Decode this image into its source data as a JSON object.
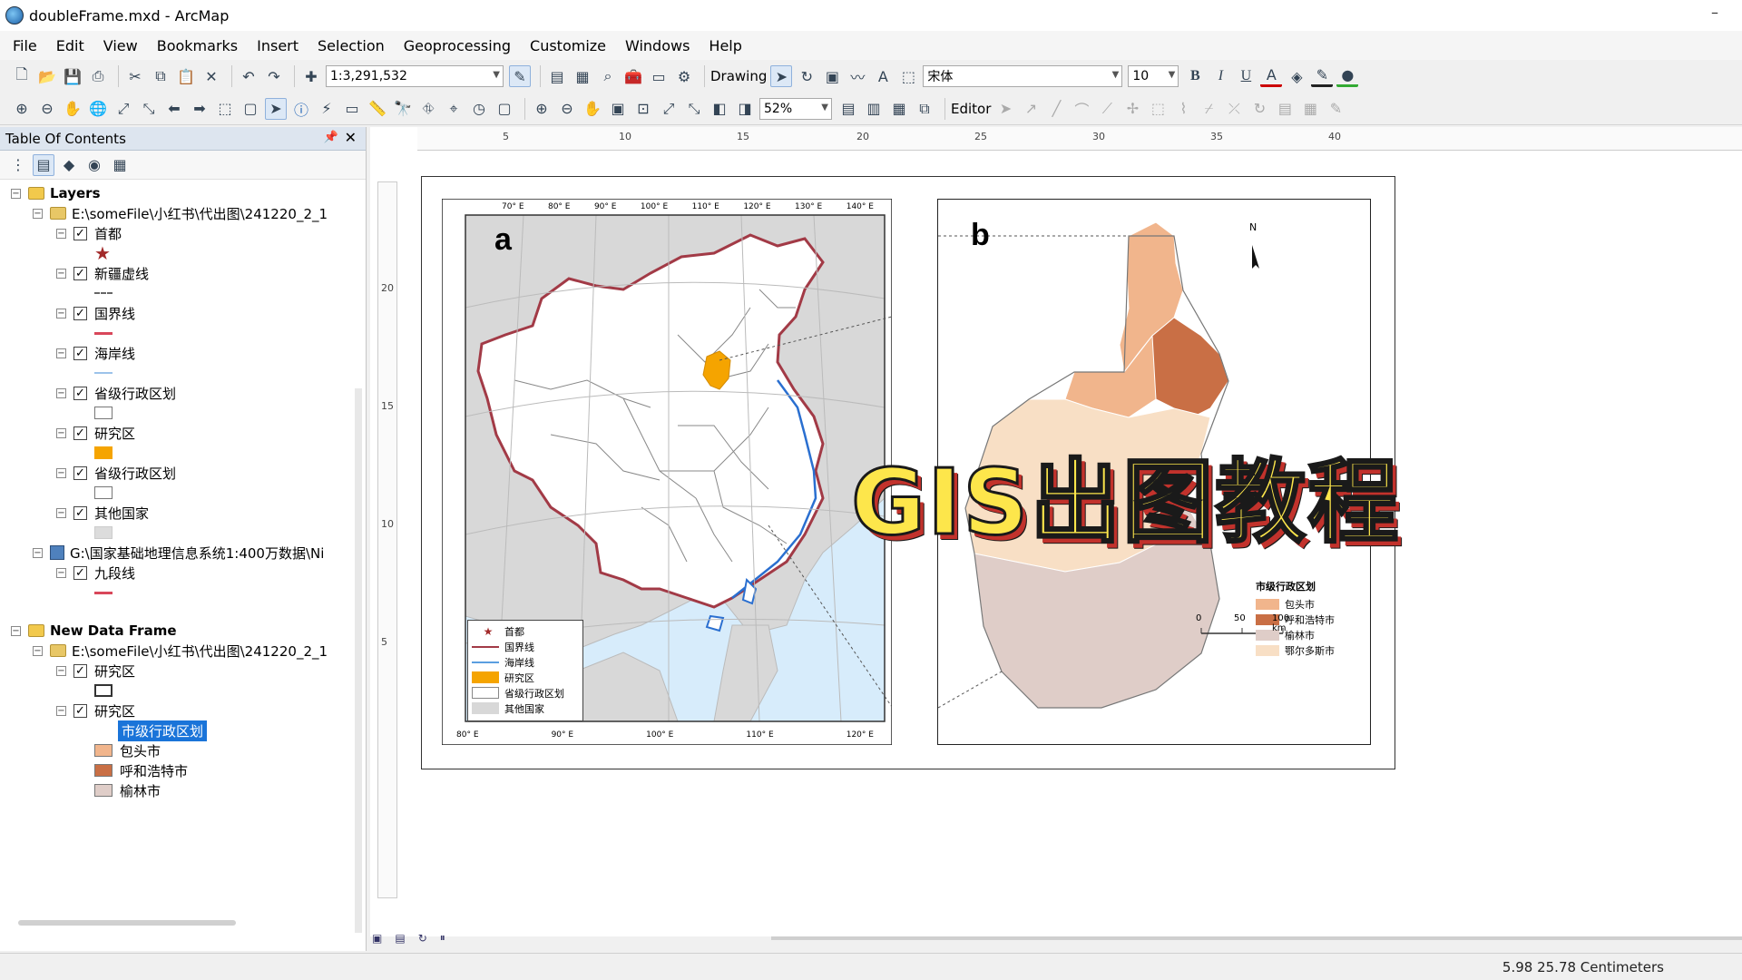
{
  "window": {
    "title": "doubleFrame.mxd - ArcMap"
  },
  "menu": [
    "File",
    "Edit",
    "View",
    "Bookmarks",
    "Insert",
    "Selection",
    "Geoprocessing",
    "Customize",
    "Windows",
    "Help"
  ],
  "toolbar": {
    "scale": "1:3,291,532",
    "drawing_label": "Drawing",
    "font_name": "宋体",
    "font_size": "10",
    "bold": "B",
    "italic": "I",
    "underline": "U",
    "zoom_percent": "52%",
    "editor_label": "Editor"
  },
  "toc": {
    "title": "Table Of Contents",
    "layers_label": "Layers",
    "path1": "E:\\someFile\\小红书\\代出图\\241220_2_1",
    "layer_capital": "首都",
    "layer_xinjiang": "新疆虚线",
    "layer_border": "国界线",
    "layer_coast": "海岸线",
    "layer_province": "省级行政区划",
    "layer_study": "研究区",
    "layer_province2": "省级行政区划",
    "layer_other": "其他国家",
    "path2": "G:\\国家基础地理信息系统1:400万数据\\Ni",
    "layer_ninedash": "九段线",
    "new_frame_label": "New Data Frame",
    "path3": "E:\\someFile\\小红书\\代出图\\241220_2_1",
    "layer_study2": "研究区",
    "layer_study3": "研究区",
    "city_field": "市级行政区划",
    "class_baotou": "包头市",
    "class_huhehaote": "呼和浩特市",
    "class_yulin": "榆林市"
  },
  "colors": {
    "study_area": "#f5a400",
    "baotou": "#f1b58c",
    "huhehaote": "#c96f45",
    "yulin": "#dfcdc8",
    "ordos": "#f8dfc5",
    "border_line": "#a23a46",
    "coast_line": "#5a9ee0",
    "other_country": "#d8d8d8",
    "sea": "#d7ecfb",
    "selection": "#1a74d9",
    "overlay_text": "#fde64b",
    "overlay_shadow": "#c2322c"
  },
  "ruler": {
    "top": [
      "5",
      "10",
      "15",
      "20",
      "25",
      "30",
      "35",
      "40"
    ],
    "left": [
      "20",
      "15",
      "10",
      "5"
    ]
  },
  "map_a": {
    "letter": "a",
    "lon_labels": [
      "70° E",
      "80° E",
      "90° E",
      "100° E",
      "110° E",
      "120° E",
      "130° E",
      "140° E"
    ],
    "lon_labels_bottom": [
      "80° E",
      "90° E",
      "100° E",
      "110° E",
      "120° E"
    ],
    "legend": [
      {
        "label": "首都",
        "icon": "star-icon"
      },
      {
        "label": "国界线",
        "icon": "line-red"
      },
      {
        "label": "海岸线",
        "icon": "line-blue"
      },
      {
        "label": "研究区",
        "icon": "swatch-orange"
      },
      {
        "label": "省级行政区划",
        "icon": "swatch-white"
      },
      {
        "label": "其他国家",
        "icon": "swatch-gray"
      }
    ]
  },
  "map_b": {
    "letter": "b",
    "north": "N",
    "legend_title": "市级行政区划",
    "legend": [
      "包头市",
      "呼和浩特市",
      "榆林市",
      "鄂尔多斯市"
    ],
    "scale_labels": [
      "0",
      "50",
      "100 km"
    ]
  },
  "overlay_title": "GIS出图教程",
  "status": {
    "coords": "5.98  25.78 Centimeters"
  }
}
